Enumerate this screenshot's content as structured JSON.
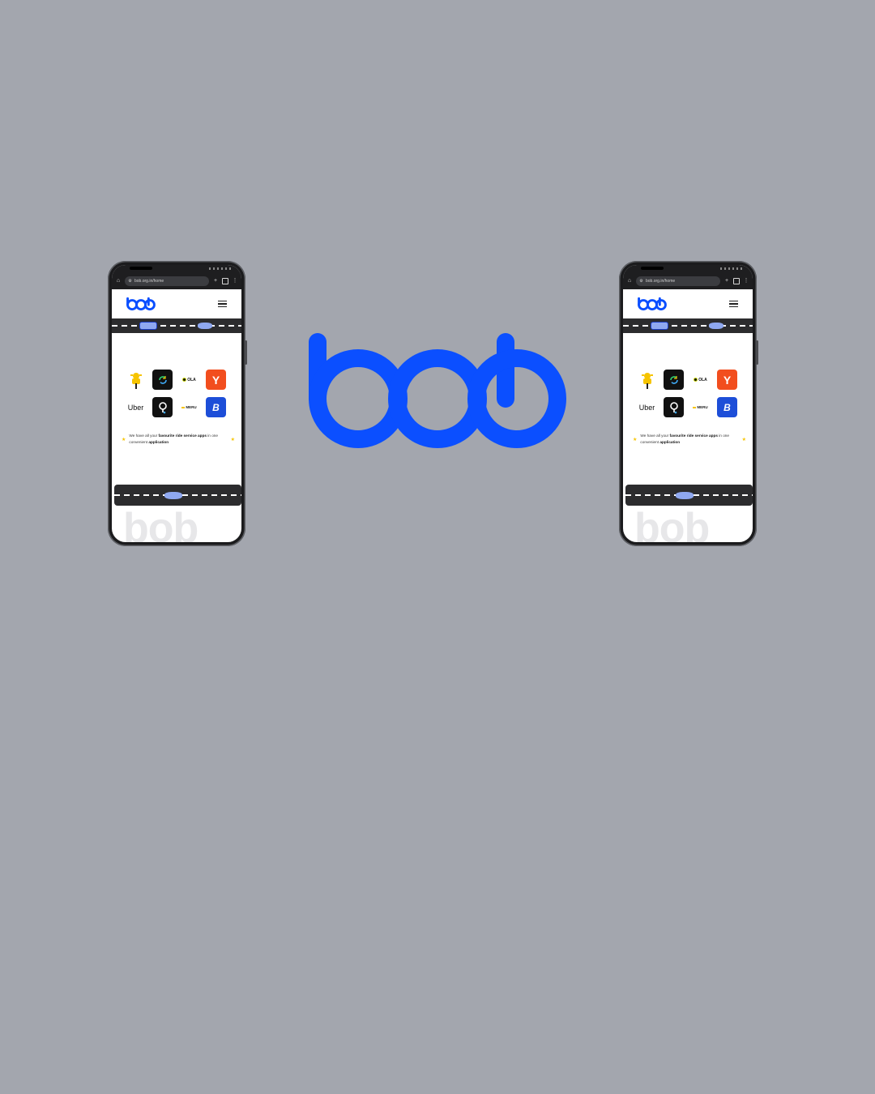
{
  "brand": {
    "name": "bob",
    "color": "#0b4fff"
  },
  "background_color": "#a3a6ae",
  "phones": [
    {
      "id": "left",
      "browser": {
        "url": "bob.org.in/home"
      },
      "site": {
        "logo": "bob",
        "apps": [
          {
            "name": "rapido-scooter-icon",
            "label": ""
          },
          {
            "name": "quick-ride-icon",
            "label": ""
          },
          {
            "name": "ola-icon",
            "label": "OLA"
          },
          {
            "name": "yatri-icon",
            "label": "Y"
          },
          {
            "name": "uber-icon",
            "label": "Uber"
          },
          {
            "name": "bluesmart-pin-icon",
            "label": ""
          },
          {
            "name": "meru-icon",
            "label": "MERU"
          },
          {
            "name": "bob-app-icon",
            "label": "B"
          }
        ],
        "tagline_pre": "We have all your ",
        "tagline_bold1": "favourite ride service apps",
        "tagline_mid": " in one convenient ",
        "tagline_bold2": "application",
        "watermark": "bob"
      }
    },
    {
      "id": "right",
      "browser": {
        "url": "bob.org.in/home"
      },
      "site": {
        "logo": "bob",
        "apps": [
          {
            "name": "rapido-scooter-icon",
            "label": ""
          },
          {
            "name": "quick-ride-icon",
            "label": ""
          },
          {
            "name": "ola-icon",
            "label": "OLA"
          },
          {
            "name": "yatri-icon",
            "label": "Y"
          },
          {
            "name": "uber-icon",
            "label": "Uber"
          },
          {
            "name": "bluesmart-pin-icon",
            "label": ""
          },
          {
            "name": "meru-icon",
            "label": "MERU"
          },
          {
            "name": "bob-app-icon",
            "label": "B"
          }
        ],
        "tagline_pre": "We have all your ",
        "tagline_bold1": "favourite ride service apps",
        "tagline_mid": " in one convenient ",
        "tagline_bold2": "application",
        "watermark": "bob"
      }
    }
  ]
}
